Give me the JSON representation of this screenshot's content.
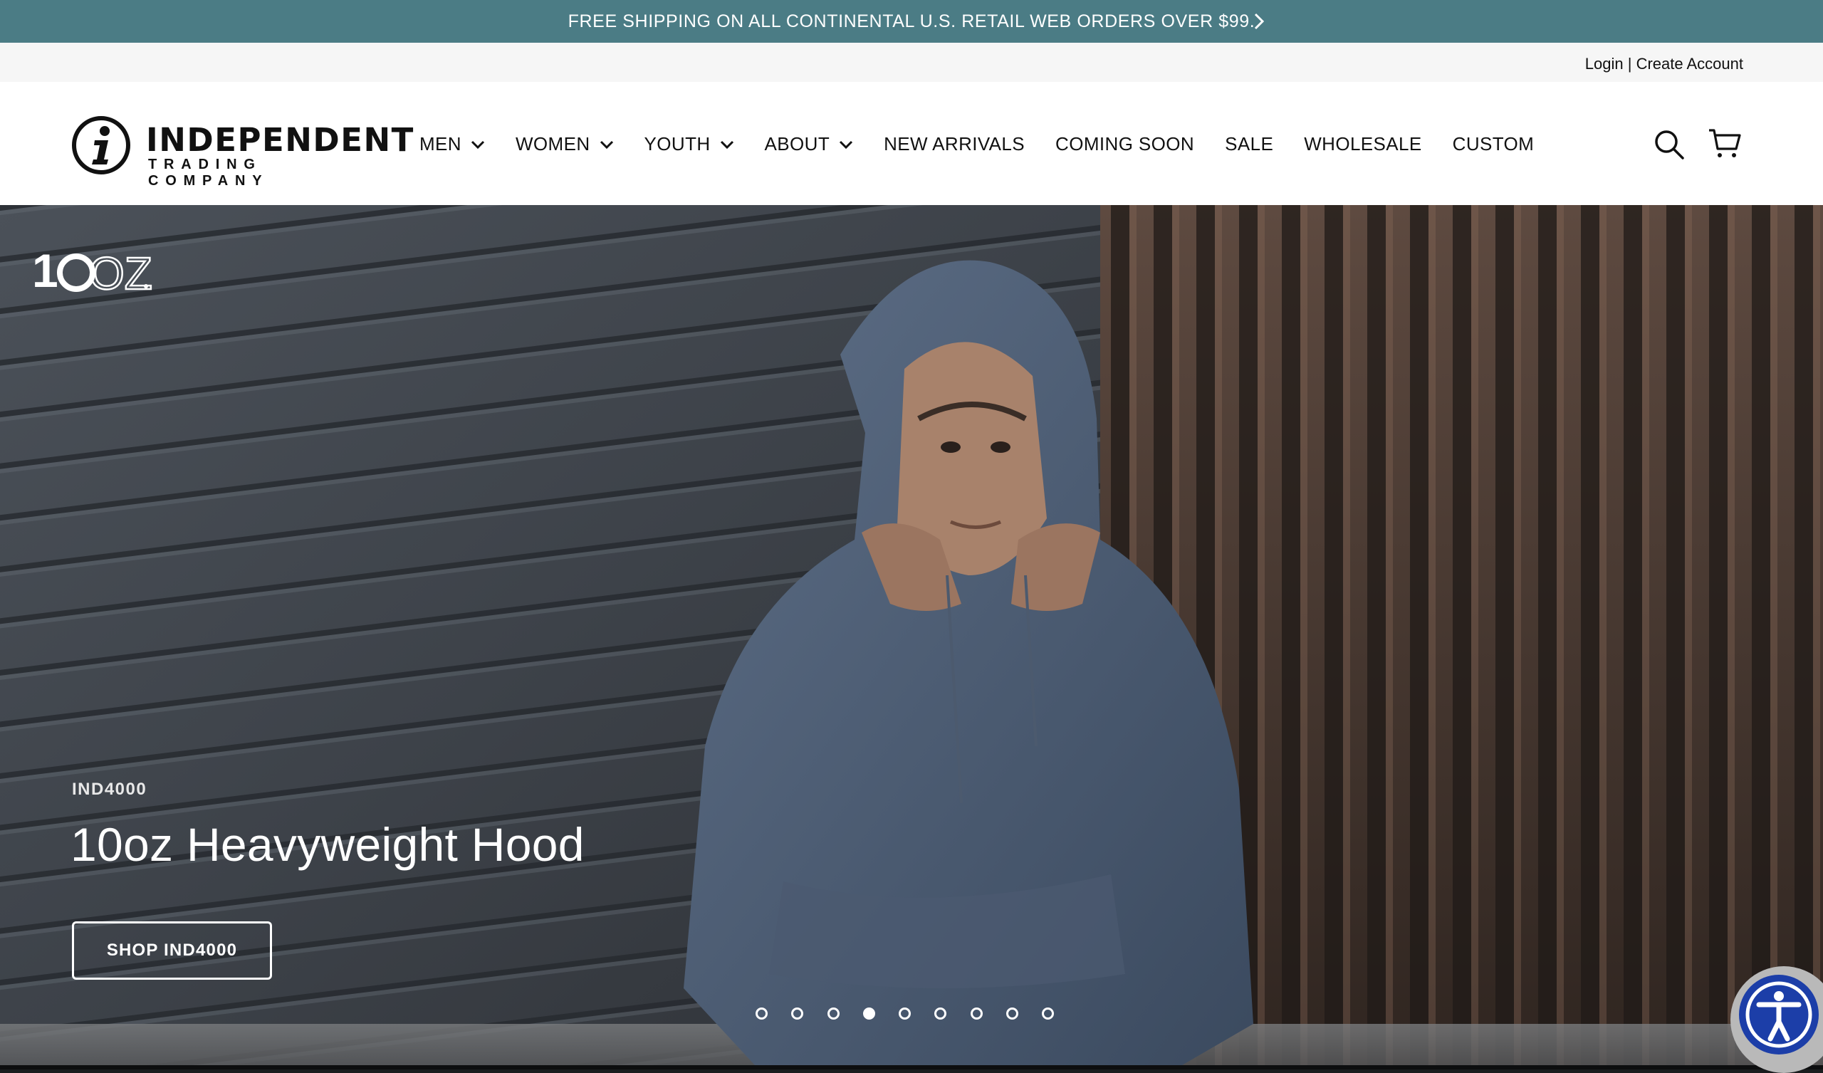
{
  "announcement": {
    "text": "FREE SHIPPING ON ALL CONTINENTAL U.S. RETAIL WEB ORDERS OVER $99.",
    "next_icon": "chevron-right-icon"
  },
  "utility": {
    "login": "Login",
    "separator": " | ",
    "create_account": "Create Account"
  },
  "brand": {
    "name_line1": "INDEPENDENT",
    "name_line2": "TRADING COMPANY",
    "logo_icon": "info-i-logo"
  },
  "nav": {
    "items": [
      {
        "label": "MEN",
        "has_dropdown": true
      },
      {
        "label": "WOMEN",
        "has_dropdown": true
      },
      {
        "label": "YOUTH",
        "has_dropdown": true
      },
      {
        "label": "ABOUT",
        "has_dropdown": true
      },
      {
        "label": "NEW ARRIVALS",
        "has_dropdown": false
      },
      {
        "label": "COMING SOON",
        "has_dropdown": false
      },
      {
        "label": "SALE",
        "has_dropdown": false
      },
      {
        "label": "WHOLESALE",
        "has_dropdown": false
      },
      {
        "label": "CUSTOM",
        "has_dropdown": false
      }
    ],
    "icons": [
      "search-icon",
      "cart-icon"
    ]
  },
  "hero": {
    "badge": "10OZ.",
    "eyebrow": "IND4000",
    "title": "10oz Heavyweight Hood",
    "cta": "SHOP IND4000",
    "slide_count": 9,
    "active_slide": 4
  },
  "accessibility": {
    "icon": "accessibility-icon"
  },
  "colors": {
    "announcement_bg": "#4b7c85",
    "utility_bg": "#f6f6f6",
    "header_bg": "#ffffff",
    "accessibility_button": "#1c3ea8"
  }
}
